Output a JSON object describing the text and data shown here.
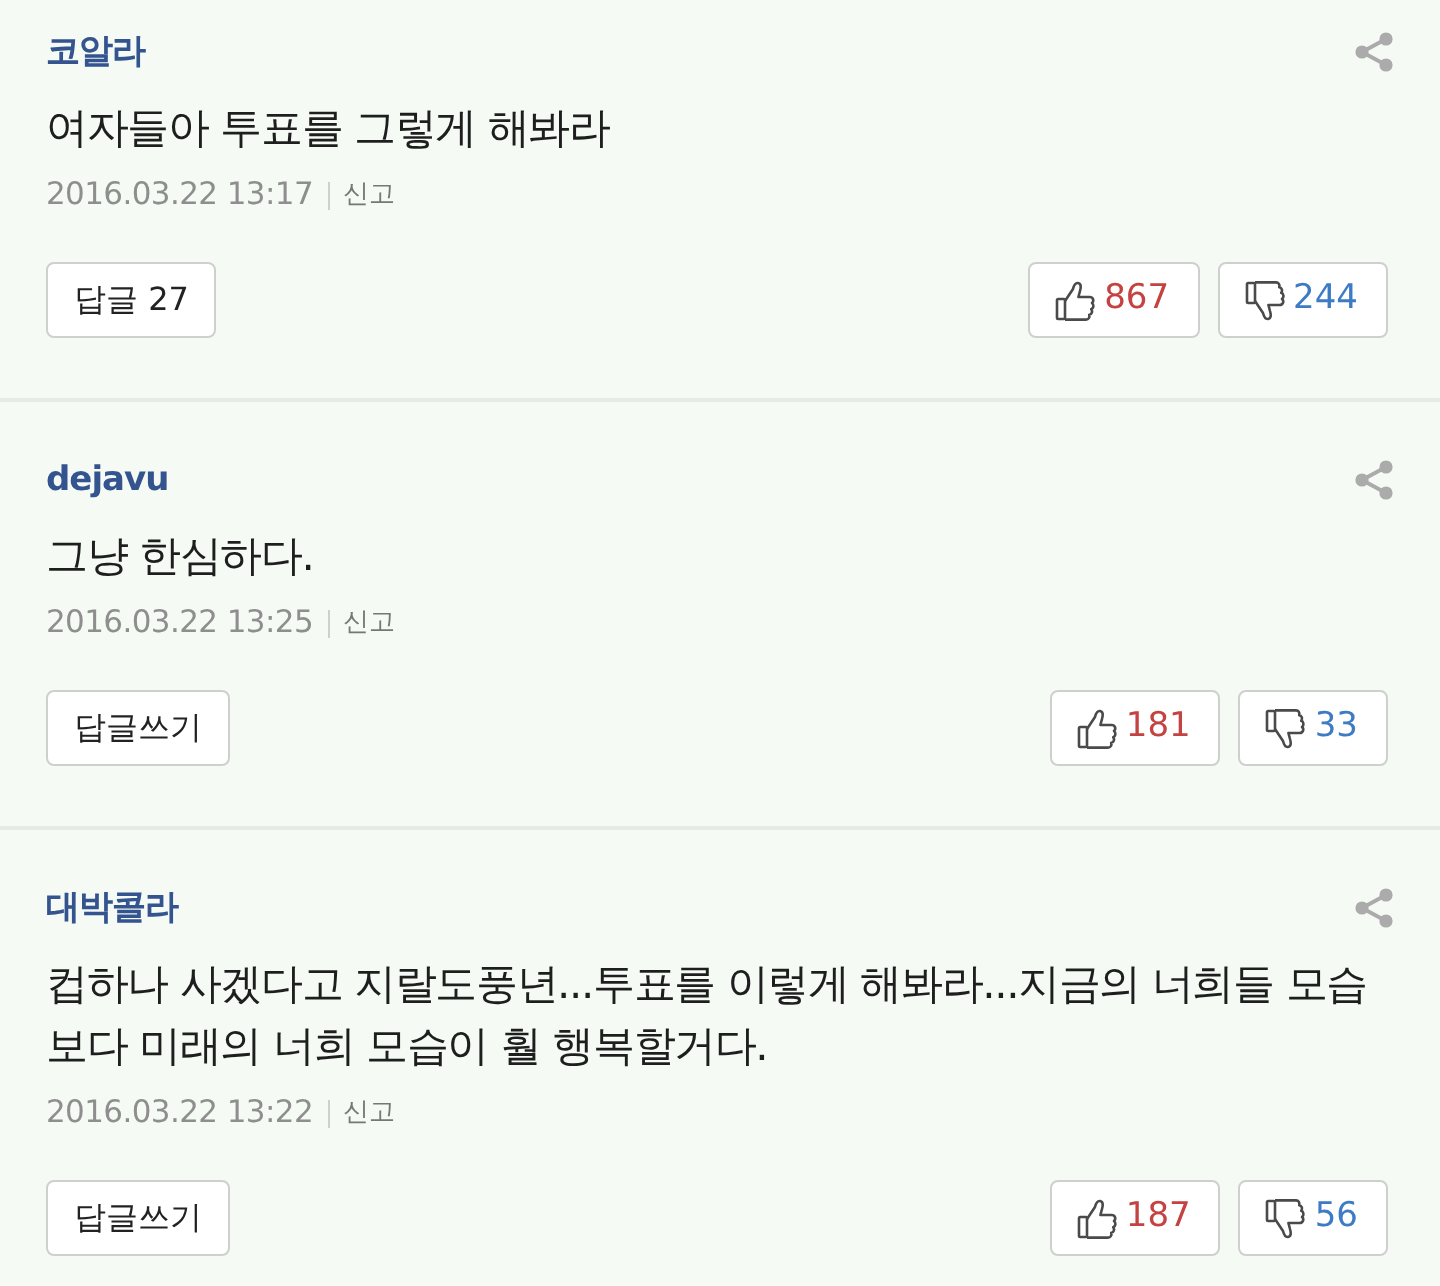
{
  "comments": [
    {
      "author": "코알라",
      "text": "여자들아 투표를 그렇게 해봐라",
      "date": "2016.03.22 13:17",
      "report": "신고",
      "reply_button": "답글 27",
      "likes": "867",
      "dislikes": "244"
    },
    {
      "author": "dejavu",
      "text": "그냥 한심하다.",
      "date": "2016.03.22 13:25",
      "report": "신고",
      "reply_button": "답글쓰기",
      "likes": "181",
      "dislikes": "33"
    },
    {
      "author": "대박콜라",
      "text": "컵하나 사겠다고 지랄도풍년...투표를 이렇게 해봐라...지금의 너희들 모습보다 미래의 너희 모습이 훨 행복할거다.",
      "date": "2016.03.22 13:22",
      "report": "신고",
      "reply_button": "답글쓰기",
      "likes": "187",
      "dislikes": "56"
    }
  ]
}
